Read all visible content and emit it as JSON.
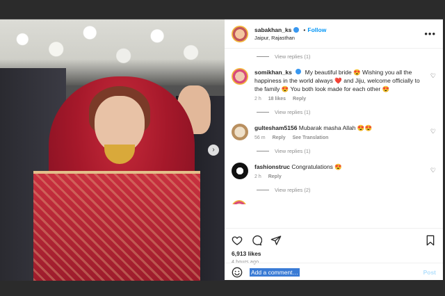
{
  "post": {
    "username": "sabakhan_ks",
    "follow_label": "Follow",
    "location": "Jaipur, Rajasthan",
    "more_label": "•••"
  },
  "comments": [
    {
      "username": "somikhan_ks",
      "text": "My beautiful bride 😍 Wishing you all the happiness in the world always ❤️ and Jiju, welcome officially to the family 😍 You both look made for each other 😍",
      "time": "2 h",
      "likes": "18 likes",
      "reply": "Reply",
      "view_replies": "View replies (1)"
    },
    {
      "username": "gultesham5156",
      "text": "Mubarak masha Allah 😍😍",
      "time": "56 m",
      "reply": "Reply",
      "translation": "See Translation",
      "view_replies": "View replies (1)"
    },
    {
      "username": "fashionstruc",
      "text": "Congratulations 😍",
      "time": "2 h",
      "reply": "Reply",
      "view_replies": "View replies (2)"
    }
  ],
  "top_view_replies": "View replies (1)",
  "engagement": {
    "likes": "6,913 likes",
    "time": "4 hours ago"
  },
  "add_comment": {
    "placeholder": "Add a comment…",
    "post_label": "Post"
  },
  "photo": {
    "next_label": "›"
  },
  "icons": [
    "heart-icon",
    "comment-icon",
    "share-icon",
    "bookmark-icon",
    "emoji-icon",
    "verified-icon"
  ],
  "colors": {
    "accent": "#0095f6",
    "text": "#262626",
    "muted": "#8e8e8e"
  }
}
